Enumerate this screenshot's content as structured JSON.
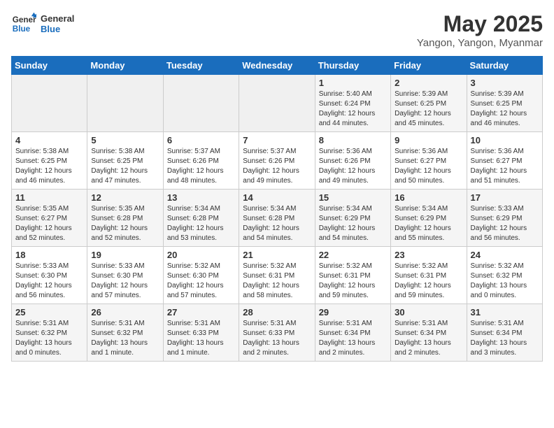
{
  "logo": {
    "line1": "General",
    "line2": "Blue"
  },
  "title": "May 2025",
  "location": "Yangon, Yangon, Myanmar",
  "weekdays": [
    "Sunday",
    "Monday",
    "Tuesday",
    "Wednesday",
    "Thursday",
    "Friday",
    "Saturday"
  ],
  "weeks": [
    [
      {
        "day": "",
        "info": ""
      },
      {
        "day": "",
        "info": ""
      },
      {
        "day": "",
        "info": ""
      },
      {
        "day": "",
        "info": ""
      },
      {
        "day": "1",
        "info": "Sunrise: 5:40 AM\nSunset: 6:24 PM\nDaylight: 12 hours\nand 44 minutes."
      },
      {
        "day": "2",
        "info": "Sunrise: 5:39 AM\nSunset: 6:25 PM\nDaylight: 12 hours\nand 45 minutes."
      },
      {
        "day": "3",
        "info": "Sunrise: 5:39 AM\nSunset: 6:25 PM\nDaylight: 12 hours\nand 46 minutes."
      }
    ],
    [
      {
        "day": "4",
        "info": "Sunrise: 5:38 AM\nSunset: 6:25 PM\nDaylight: 12 hours\nand 46 minutes."
      },
      {
        "day": "5",
        "info": "Sunrise: 5:38 AM\nSunset: 6:25 PM\nDaylight: 12 hours\nand 47 minutes."
      },
      {
        "day": "6",
        "info": "Sunrise: 5:37 AM\nSunset: 6:26 PM\nDaylight: 12 hours\nand 48 minutes."
      },
      {
        "day": "7",
        "info": "Sunrise: 5:37 AM\nSunset: 6:26 PM\nDaylight: 12 hours\nand 49 minutes."
      },
      {
        "day": "8",
        "info": "Sunrise: 5:36 AM\nSunset: 6:26 PM\nDaylight: 12 hours\nand 49 minutes."
      },
      {
        "day": "9",
        "info": "Sunrise: 5:36 AM\nSunset: 6:27 PM\nDaylight: 12 hours\nand 50 minutes."
      },
      {
        "day": "10",
        "info": "Sunrise: 5:36 AM\nSunset: 6:27 PM\nDaylight: 12 hours\nand 51 minutes."
      }
    ],
    [
      {
        "day": "11",
        "info": "Sunrise: 5:35 AM\nSunset: 6:27 PM\nDaylight: 12 hours\nand 52 minutes."
      },
      {
        "day": "12",
        "info": "Sunrise: 5:35 AM\nSunset: 6:28 PM\nDaylight: 12 hours\nand 52 minutes."
      },
      {
        "day": "13",
        "info": "Sunrise: 5:34 AM\nSunset: 6:28 PM\nDaylight: 12 hours\nand 53 minutes."
      },
      {
        "day": "14",
        "info": "Sunrise: 5:34 AM\nSunset: 6:28 PM\nDaylight: 12 hours\nand 54 minutes."
      },
      {
        "day": "15",
        "info": "Sunrise: 5:34 AM\nSunset: 6:29 PM\nDaylight: 12 hours\nand 54 minutes."
      },
      {
        "day": "16",
        "info": "Sunrise: 5:34 AM\nSunset: 6:29 PM\nDaylight: 12 hours\nand 55 minutes."
      },
      {
        "day": "17",
        "info": "Sunrise: 5:33 AM\nSunset: 6:29 PM\nDaylight: 12 hours\nand 56 minutes."
      }
    ],
    [
      {
        "day": "18",
        "info": "Sunrise: 5:33 AM\nSunset: 6:30 PM\nDaylight: 12 hours\nand 56 minutes."
      },
      {
        "day": "19",
        "info": "Sunrise: 5:33 AM\nSunset: 6:30 PM\nDaylight: 12 hours\nand 57 minutes."
      },
      {
        "day": "20",
        "info": "Sunrise: 5:32 AM\nSunset: 6:30 PM\nDaylight: 12 hours\nand 57 minutes."
      },
      {
        "day": "21",
        "info": "Sunrise: 5:32 AM\nSunset: 6:31 PM\nDaylight: 12 hours\nand 58 minutes."
      },
      {
        "day": "22",
        "info": "Sunrise: 5:32 AM\nSunset: 6:31 PM\nDaylight: 12 hours\nand 59 minutes."
      },
      {
        "day": "23",
        "info": "Sunrise: 5:32 AM\nSunset: 6:31 PM\nDaylight: 12 hours\nand 59 minutes."
      },
      {
        "day": "24",
        "info": "Sunrise: 5:32 AM\nSunset: 6:32 PM\nDaylight: 13 hours\nand 0 minutes."
      }
    ],
    [
      {
        "day": "25",
        "info": "Sunrise: 5:31 AM\nSunset: 6:32 PM\nDaylight: 13 hours\nand 0 minutes."
      },
      {
        "day": "26",
        "info": "Sunrise: 5:31 AM\nSunset: 6:32 PM\nDaylight: 13 hours\nand 1 minute."
      },
      {
        "day": "27",
        "info": "Sunrise: 5:31 AM\nSunset: 6:33 PM\nDaylight: 13 hours\nand 1 minute."
      },
      {
        "day": "28",
        "info": "Sunrise: 5:31 AM\nSunset: 6:33 PM\nDaylight: 13 hours\nand 2 minutes."
      },
      {
        "day": "29",
        "info": "Sunrise: 5:31 AM\nSunset: 6:34 PM\nDaylight: 13 hours\nand 2 minutes."
      },
      {
        "day": "30",
        "info": "Sunrise: 5:31 AM\nSunset: 6:34 PM\nDaylight: 13 hours\nand 2 minutes."
      },
      {
        "day": "31",
        "info": "Sunrise: 5:31 AM\nSunset: 6:34 PM\nDaylight: 13 hours\nand 3 minutes."
      }
    ]
  ]
}
